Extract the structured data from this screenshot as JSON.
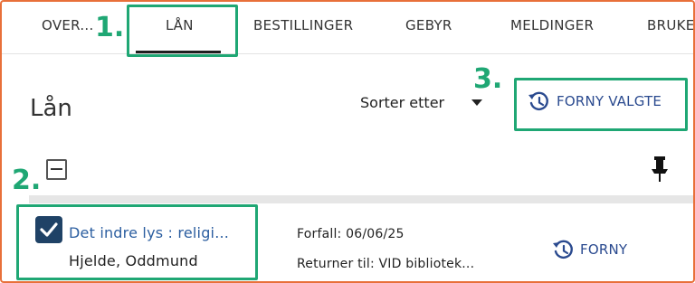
{
  "tabs": [
    {
      "label": "OVER..."
    },
    {
      "label": "LÅN"
    },
    {
      "label": "BESTILLINGER"
    },
    {
      "label": "GEBYR"
    },
    {
      "label": "MELDINGER"
    },
    {
      "label": "BRUKE"
    }
  ],
  "callouts": [
    "1.",
    "2.",
    "3."
  ],
  "page_title": "Lån",
  "sort": {
    "label": "Sorter etter"
  },
  "renew_selected_label": "FORNY VALGTE",
  "loan": {
    "title": "Det indre lys : religi...",
    "author": "Hjelde, Oddmund",
    "due": "Forfall: 06/06/25",
    "return_to": "Returner til: VID bibliotek...",
    "renew_label": "FORNY"
  },
  "colors": {
    "accent_green": "#1fa774",
    "link_blue": "#2a4a8f",
    "checkbox_navy": "#1f4266",
    "frame_orange": "#e8703a"
  }
}
